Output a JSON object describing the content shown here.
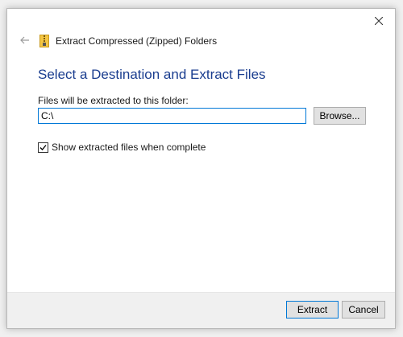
{
  "window": {
    "header_title": "Extract Compressed (Zipped) Folders",
    "close_icon": "close-icon",
    "back_icon": "back-arrow-icon",
    "zip_icon": "zip-folder-icon"
  },
  "main": {
    "title": "Select a Destination and Extract Files",
    "dest_label": "Files will be extracted to this folder:",
    "path_value": "C:\\",
    "browse_label": "Browse...",
    "show_files_label": "Show extracted files when complete",
    "show_files_checked": true
  },
  "footer": {
    "extract_label": "Extract",
    "cancel_label": "Cancel"
  },
  "colors": {
    "title": "#1a3d8f",
    "accent": "#0078d7",
    "footer_bg": "#f0f0f0"
  }
}
